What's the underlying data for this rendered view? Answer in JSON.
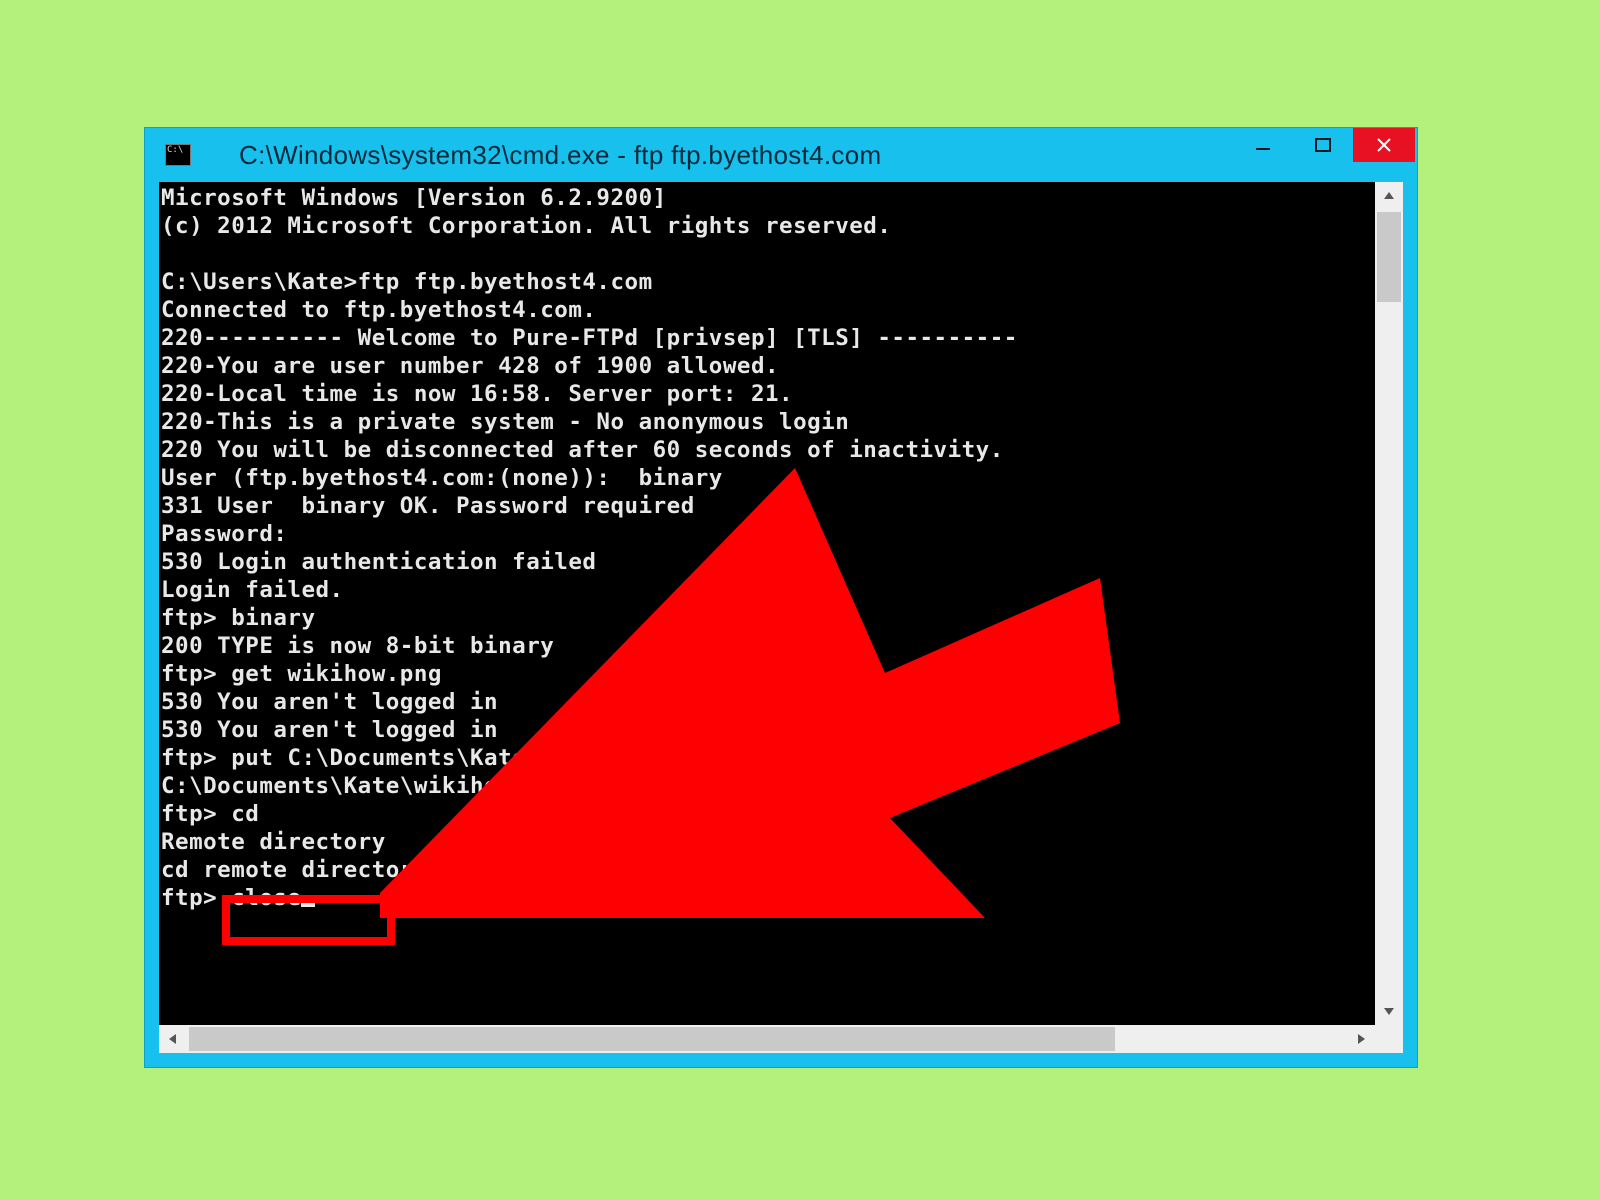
{
  "window": {
    "title": "C:\\Windows\\system32\\cmd.exe - ftp  ftp.byethost4.com"
  },
  "terminal": {
    "lines": [
      "Microsoft Windows [Version 6.2.9200]",
      "(c) 2012 Microsoft Corporation. All rights reserved.",
      "",
      "C:\\Users\\Kate>ftp ftp.byethost4.com",
      "Connected to ftp.byethost4.com.",
      "220---------- Welcome to Pure-FTPd [privsep] [TLS] ----------",
      "220-You are user number 428 of 1900 allowed.",
      "220-Local time is now 16:58. Server port: 21.",
      "220-This is a private system - No anonymous login",
      "220 You will be disconnected after 60 seconds of inactivity.",
      "User (ftp.byethost4.com:(none)):  binary",
      "331 User  binary OK. Password required",
      "Password:",
      "530 Login authentication failed",
      "Login failed.",
      "ftp> binary",
      "200 TYPE is now 8-bit binary",
      "ftp> get wikihow.png",
      "530 You aren't logged in",
      "530 You aren't logged in",
      "ftp> put C:\\Documents\\Kate\\wikihow.png",
      "C:\\Documents\\Kate\\wikihow.png: File not found",
      "ftp> cd",
      "Remote directory",
      "cd remote directory"
    ],
    "prompt_prefix": "ftp> ",
    "current_input": "close"
  },
  "annotation": {
    "highlighted_command": "close"
  }
}
